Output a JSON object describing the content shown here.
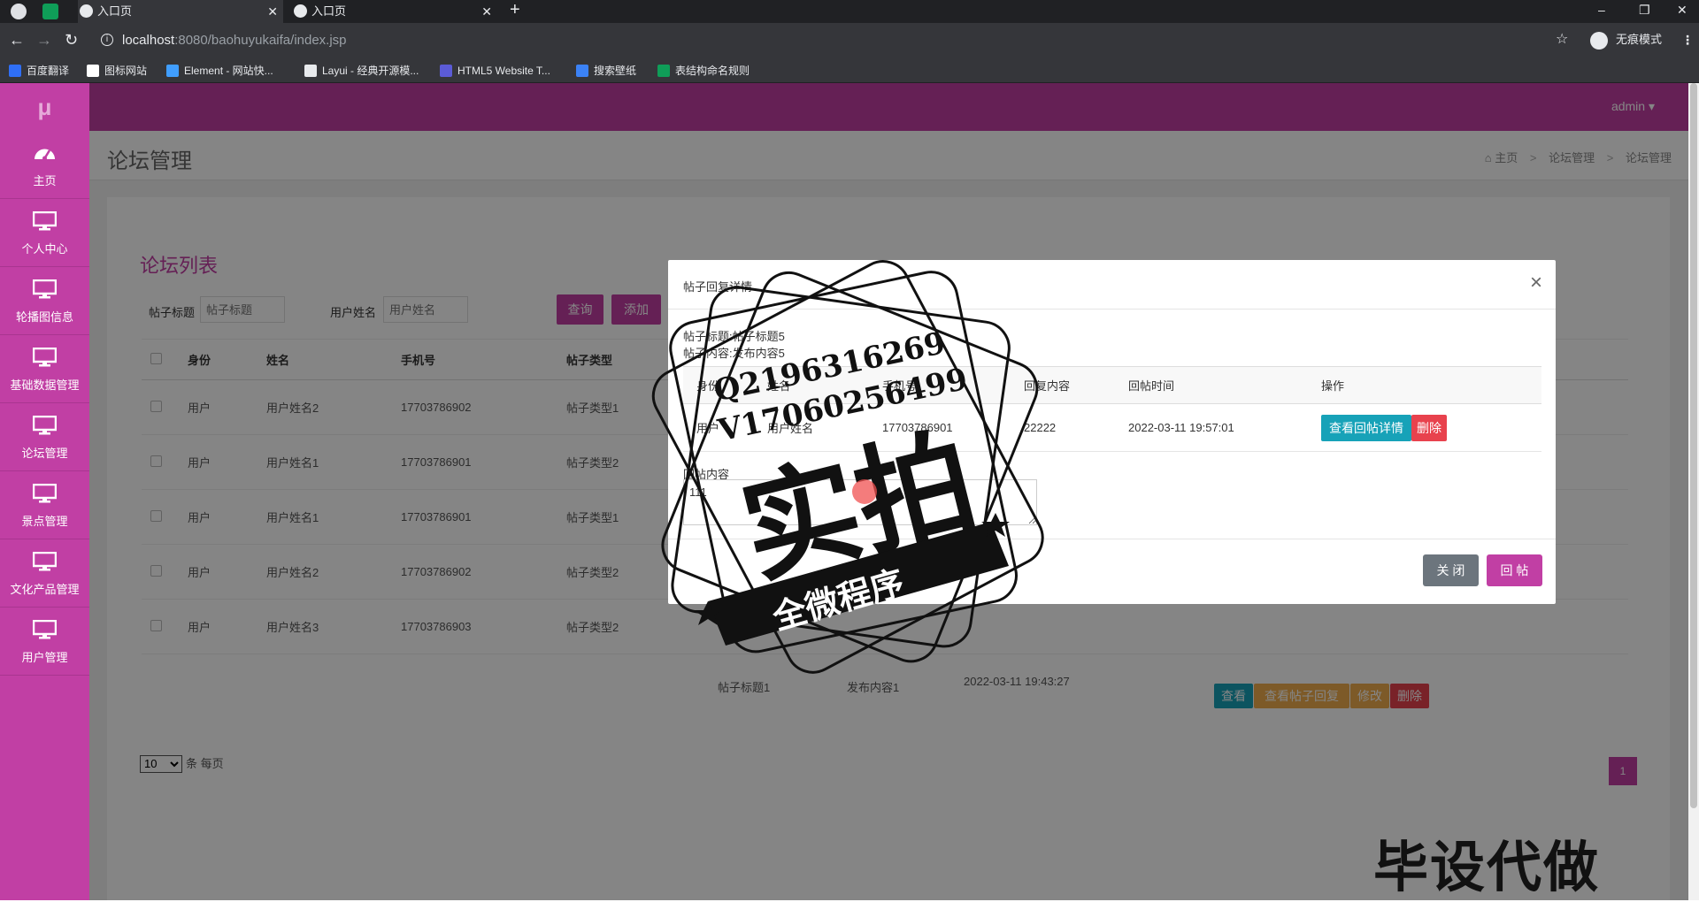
{
  "browser": {
    "tabs": [
      {
        "title": "入口页",
        "active": true
      },
      {
        "title": "入口页",
        "active": false
      }
    ],
    "url_host": "localhost",
    "url_path": ":8080/baohuyukaifa/index.jsp",
    "incognito_label": "无痕模式",
    "bookmarks": [
      {
        "label": "百度翻译",
        "color": "#2f6ff6"
      },
      {
        "label": "图标网站",
        "color": "#ffffff"
      },
      {
        "label": "Element - 网站快...",
        "color": "#409eff"
      },
      {
        "label": "Layui - 经典开源模...",
        "color": "#e8eaed"
      },
      {
        "label": "HTML5 Website T...",
        "color": "#5b5bd6"
      },
      {
        "label": "搜索壁纸",
        "color": "#3b82f6"
      },
      {
        "label": "表结构命名规则",
        "color": "#0f9d58"
      }
    ]
  },
  "app": {
    "logo": "μ",
    "user": "admin ▾",
    "accent": "#c13fa4",
    "sidebar": [
      {
        "label": "主页",
        "icon": "dashboard-icon"
      },
      {
        "label": "个人中心",
        "icon": "monitor-icon"
      },
      {
        "label": "轮播图信息",
        "icon": "monitor-icon"
      },
      {
        "label": "基础数据管理",
        "icon": "monitor-icon"
      },
      {
        "label": "论坛管理",
        "icon": "monitor-icon"
      },
      {
        "label": "景点管理",
        "icon": "monitor-icon"
      },
      {
        "label": "文化产品管理",
        "icon": "monitor-icon"
      },
      {
        "label": "用户管理",
        "icon": "monitor-icon"
      }
    ],
    "page_title": "论坛管理",
    "breadcrumb": [
      "主页",
      "论坛管理",
      "论坛管理"
    ],
    "list_title": "论坛列表",
    "filters": [
      {
        "label": "帖子标题",
        "placeholder": "帖子标题"
      },
      {
        "label": "用户姓名",
        "placeholder": "用户姓名"
      }
    ],
    "buttons": {
      "query": "查询",
      "add": "添加"
    },
    "table": {
      "columns": [
        "身份",
        "姓名",
        "手机号",
        "帖子类型"
      ],
      "rows": [
        [
          "用户",
          "用户姓名2",
          "17703786902",
          "帖子类型1"
        ],
        [
          "用户",
          "用户姓名1",
          "17703786901",
          "帖子类型2"
        ],
        [
          "用户",
          "用户姓名1",
          "17703786901",
          "帖子类型1"
        ],
        [
          "用户",
          "用户姓名2",
          "17703786902",
          "帖子类型2"
        ],
        [
          "用户",
          "用户姓名3",
          "17703786903",
          "帖子类型2"
        ]
      ]
    },
    "partial_row": {
      "title_fragment": "帖子标题1",
      "content_fragment": "发布内容1",
      "time_fragment": "2022-03-11 19:43:27",
      "actions": [
        "查看",
        "查看帖子回复",
        "修改",
        "删除"
      ]
    },
    "page_size": "10",
    "page_size_suffix": "条 每页",
    "current_page": "1"
  },
  "modal": {
    "title": "帖子回复详情",
    "close_symbol": "×",
    "post_title_line": "帖子标题:帖子标题5",
    "post_content_line": "帖子内容:发布内容5",
    "columns": [
      "身份",
      "姓名",
      "手机号",
      "回复内容",
      "回帖时间",
      "操作"
    ],
    "rows": [
      {
        "identity": "用户",
        "name": "用户姓名",
        "phone": "17703786901",
        "content": "22222",
        "time": "2022-03-11 19:57:01"
      }
    ],
    "view_btn": "查看回帖详情",
    "delete_btn": "删除",
    "reply_label": "回帖内容",
    "reply_value": "111",
    "close_btn": "关 闭",
    "reply_btn": "回 帖"
  },
  "stamp": {
    "line1": "Q2196316269",
    "line2": "V17060256499",
    "big": "实拍",
    "banner": "全微程序"
  },
  "watermark": "毕设代做"
}
